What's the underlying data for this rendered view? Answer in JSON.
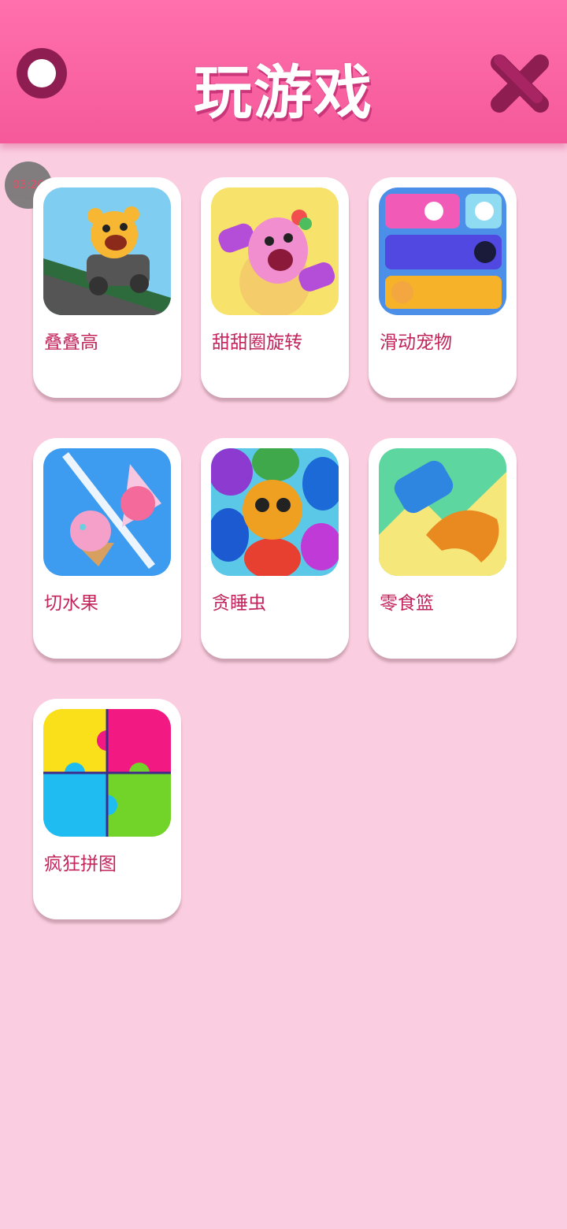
{
  "header": {
    "title": "玩游戏",
    "menu_icon": "circle-menu-icon",
    "close_icon": "close-x-icon",
    "background": "#f5599a"
  },
  "timer": {
    "text": "03:20"
  },
  "games": [
    {
      "label": "叠叠高",
      "icon": "bear-car-icon"
    },
    {
      "label": "甜甜圈旋转",
      "icon": "pink-monster-icon"
    },
    {
      "label": "滑动宠物",
      "icon": "slide-pets-icon"
    },
    {
      "label": "切水果",
      "icon": "ice-cream-slice-icon"
    },
    {
      "label": "贪睡虫",
      "icon": "sleepy-bug-icon"
    },
    {
      "label": "零食篮",
      "icon": "snack-basket-icon"
    },
    {
      "label": "疯狂拼图",
      "icon": "puzzle-icon"
    }
  ],
  "colors": {
    "background": "#fbcde0",
    "label": "#c2245b",
    "card": "#ffffff"
  }
}
